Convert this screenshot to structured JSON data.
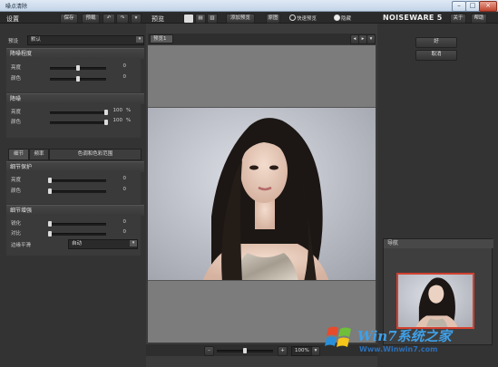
{
  "window": {
    "title": "噪点清除",
    "minimize": "–",
    "maximize": "□",
    "close": "×"
  },
  "left": {
    "header_title": "设置",
    "save_label": "保存",
    "load_label": "预载",
    "preset_label": "预设",
    "preset_value": "默认",
    "luminance_noise": {
      "title": "降噪程度",
      "rows": [
        {
          "label": "亮度",
          "value": "0",
          "level": 0.5
        },
        {
          "label": "颜色",
          "value": "0",
          "level": 0.5
        }
      ]
    },
    "denoise": {
      "title": "降噪",
      "rows": [
        {
          "label": "亮度",
          "value": "100",
          "unit": "%",
          "level": 1.0
        },
        {
          "label": "颜色",
          "value": "100",
          "unit": "%",
          "level": 1.0
        }
      ]
    },
    "tabs": [
      "细节",
      "频率",
      "色调和色彩范围"
    ],
    "detail_protect": {
      "title": "细节保护",
      "rows": [
        {
          "label": "亮度",
          "value": "0",
          "level": 0.0
        },
        {
          "label": "颜色",
          "value": "0",
          "level": 0.0
        }
      ]
    },
    "detail_enhance": {
      "title": "细节增强",
      "rows": [
        {
          "label": "锐化",
          "value": "0",
          "level": 0.0
        },
        {
          "label": "对比",
          "value": "0",
          "level": 0.0
        }
      ],
      "edge_label": "边缘平滑",
      "edge_value": "自动"
    }
  },
  "center": {
    "preview_label": "预览",
    "add_preview_label": "添加预览",
    "original_label": "原图",
    "fast_preview_label": "快速预览",
    "fast_preview_icon": "radio-off",
    "hide_label": "隐藏",
    "hide_icon": "radio-on",
    "preview_tab": "预览1",
    "zoom_value": "100%",
    "zoom_minus": "–",
    "zoom_plus": "+",
    "zoom_level": 0.5
  },
  "right": {
    "brand": "NOISEWARE 5",
    "about_label": "关于",
    "help_label": "帮助",
    "ok_label": "好",
    "cancel_label": "取消",
    "navigator_label": "导航"
  },
  "watermark": {
    "brand": "Win7系统之家",
    "url": "Www.Winwin7.com"
  }
}
